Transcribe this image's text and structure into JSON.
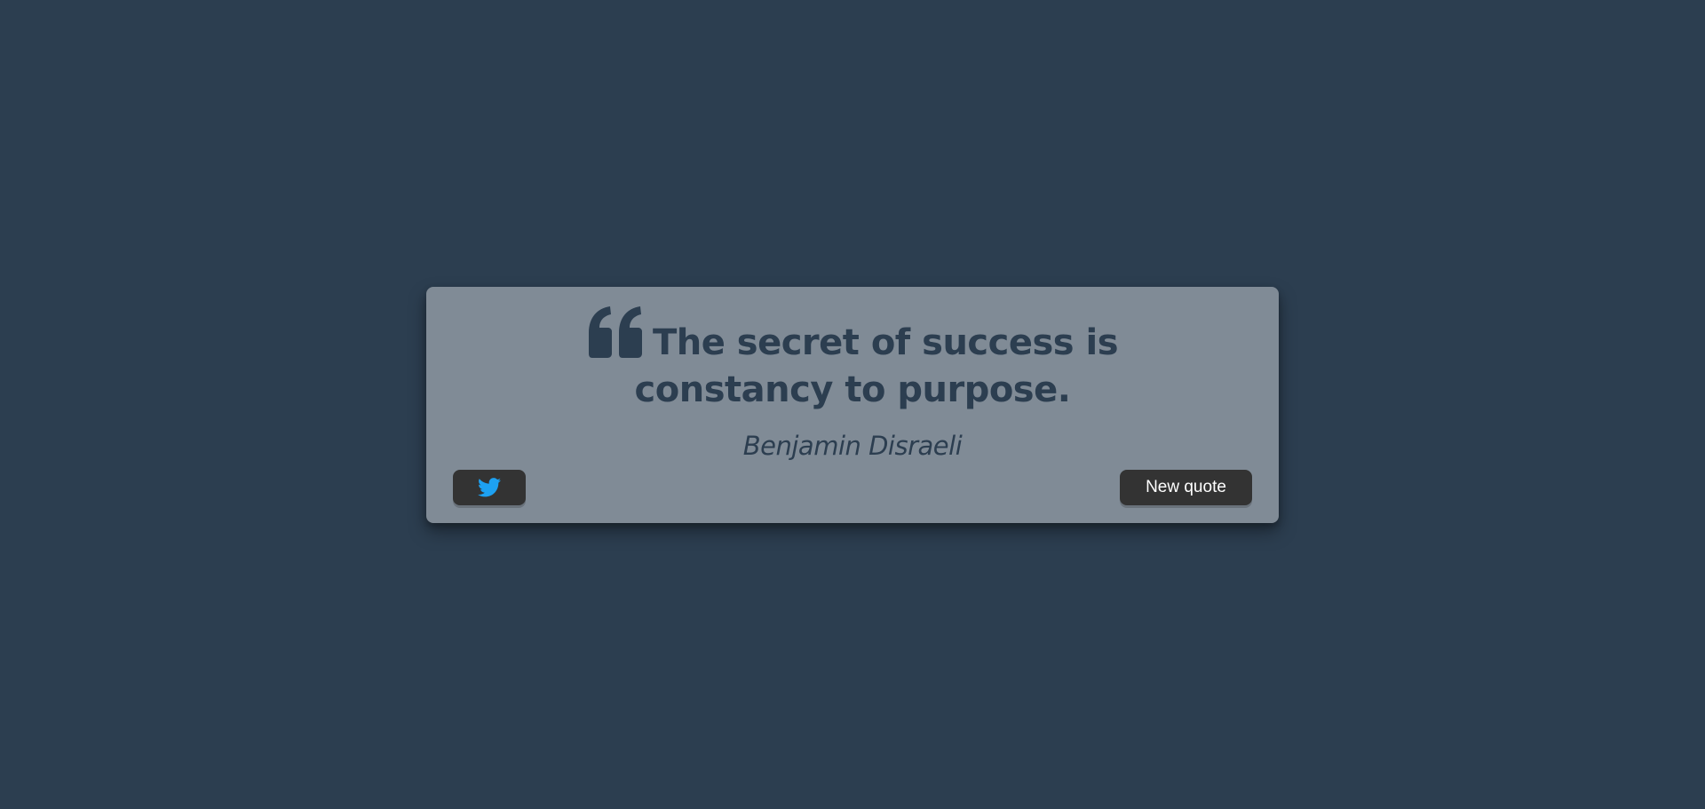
{
  "quote": {
    "text": "The secret of success is constancy to purpose.",
    "author": "Benjamin Disraeli",
    "icon": "quote-left-icon"
  },
  "actions": {
    "tweet_icon": "twitter-icon",
    "new_quote_label": "New quote"
  },
  "colors": {
    "background": "#2c3e50",
    "card": "#808b96",
    "text": "#2c3e50",
    "button": "#333333",
    "twitter": "#1da1f2"
  }
}
